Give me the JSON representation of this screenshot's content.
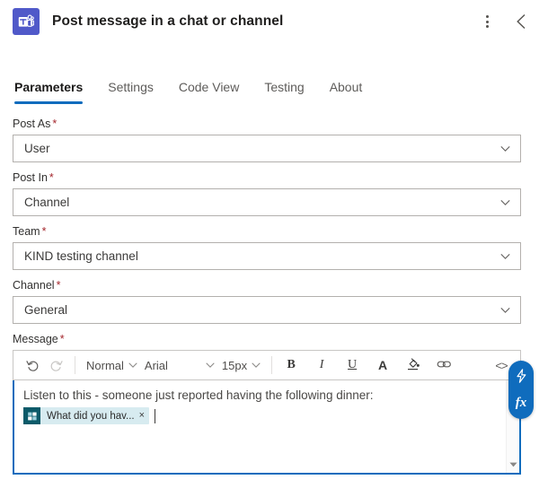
{
  "header": {
    "app_icon": "microsoft-teams-icon",
    "title": "Post message in a chat or channel",
    "more_menu": "more-options-icon",
    "back": "back-chevron-icon"
  },
  "tabs": [
    {
      "label": "Parameters",
      "active": true
    },
    {
      "label": "Settings",
      "active": false
    },
    {
      "label": "Code View",
      "active": false
    },
    {
      "label": "Testing",
      "active": false
    },
    {
      "label": "About",
      "active": false
    }
  ],
  "fields": [
    {
      "label": "Post As",
      "required": "*",
      "value": "User"
    },
    {
      "label": "Post In",
      "required": "*",
      "value": "Channel"
    },
    {
      "label": "Team",
      "required": "*",
      "value": "KIND testing channel"
    },
    {
      "label": "Channel",
      "required": "*",
      "value": "General"
    }
  ],
  "message": {
    "label": "Message",
    "required": "*",
    "toolbar": {
      "undo": "undo-icon",
      "redo": "redo-icon",
      "style": "Normal",
      "font": "Arial",
      "size": "15px",
      "bold": "B",
      "italic": "I",
      "underline": "U",
      "font_color": "A",
      "highlight": "highlight-icon",
      "link": "link-icon",
      "code_view": "<>"
    },
    "body_text": "Listen to this - someone just reported having the following dinner:",
    "token": {
      "icon": "microsoft-forms-icon",
      "label": "What did you hav...",
      "remove": "×"
    },
    "scroll_down": "scroll-down-arrow-icon"
  },
  "dynamic_panel": {
    "dynamic_content": "lightning-bolt-icon",
    "expression": "fx"
  },
  "colors": {
    "accent": "#0f6cbd",
    "teams_purple": "#5059c9",
    "required_red": "#a4262c",
    "token_bg": "#d7ebf0",
    "token_icon_bg": "#0b5a69"
  }
}
